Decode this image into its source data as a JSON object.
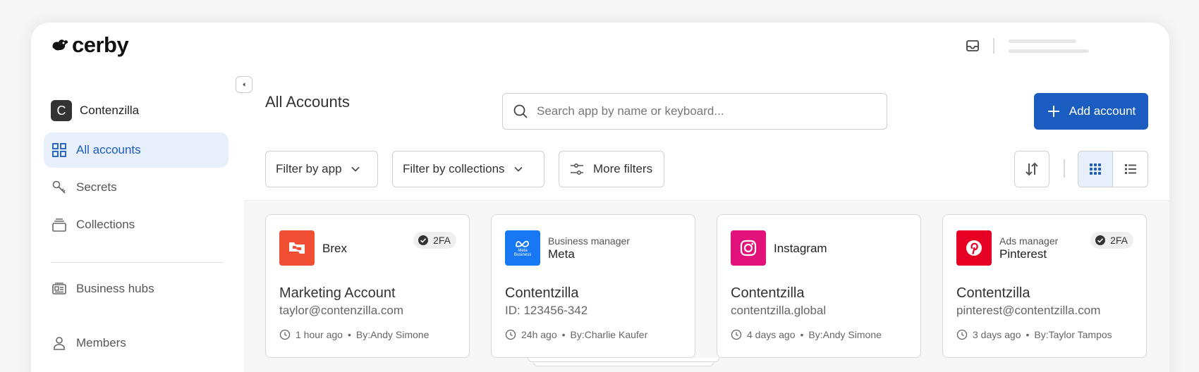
{
  "brand": {
    "name": "cerby"
  },
  "sidebar": {
    "workspace": {
      "initial": "C",
      "name": "Contenzilla"
    },
    "items": [
      {
        "label": "All accounts",
        "icon": "grid-icon",
        "active": true
      },
      {
        "label": "Secrets",
        "icon": "key-icon",
        "active": false
      },
      {
        "label": "Collections",
        "icon": "collections-icon",
        "active": false
      },
      {
        "label": "Business hubs",
        "icon": "business-hub-icon",
        "active": false
      },
      {
        "label": "Members",
        "icon": "user-icon",
        "active": false
      }
    ]
  },
  "header": {
    "title": "All Accounts",
    "search_placeholder": "Search app by name or keyboard...",
    "add_button": "Add account"
  },
  "filters": {
    "by_app": "Filter by app",
    "by_collections": "Filter by collections",
    "more": "More filters"
  },
  "view": {
    "mode": "grid"
  },
  "cards": [
    {
      "app": "Brex",
      "app_sub": "",
      "badge": "2FA",
      "logo_color": "#f04f34",
      "account": "Marketing Account",
      "detail": "taylor@contenzilla.com",
      "time": "1 hour ago",
      "by": "By:Andy Simone"
    },
    {
      "app": "Meta",
      "app_sub": "Business manager",
      "badge": "",
      "logo_color": "#1877f2",
      "account": "Contentzilla",
      "detail": "ID: 123456-342",
      "time": "24h ago",
      "by": "By:Charlie Kaufer"
    },
    {
      "app": "Instagram",
      "app_sub": "",
      "badge": "",
      "logo_color": "#e1127a",
      "account": "Contentzilla",
      "detail": "contentzilla.global",
      "time": "4 days ago",
      "by": "By:Andy Simone"
    },
    {
      "app": "Pinterest",
      "app_sub": "Ads manager",
      "badge": "2FA",
      "logo_color": "#e60023",
      "account": "Contentzilla",
      "detail": "pinterest@contentzilla.com",
      "time": "3 days ago",
      "by": "By:Taylor Tampos"
    }
  ],
  "meta_logo_text": "Meta Business",
  "separator": "•",
  "colors": {
    "accent": "#1a5cbf",
    "active_bg": "#e7effa"
  }
}
